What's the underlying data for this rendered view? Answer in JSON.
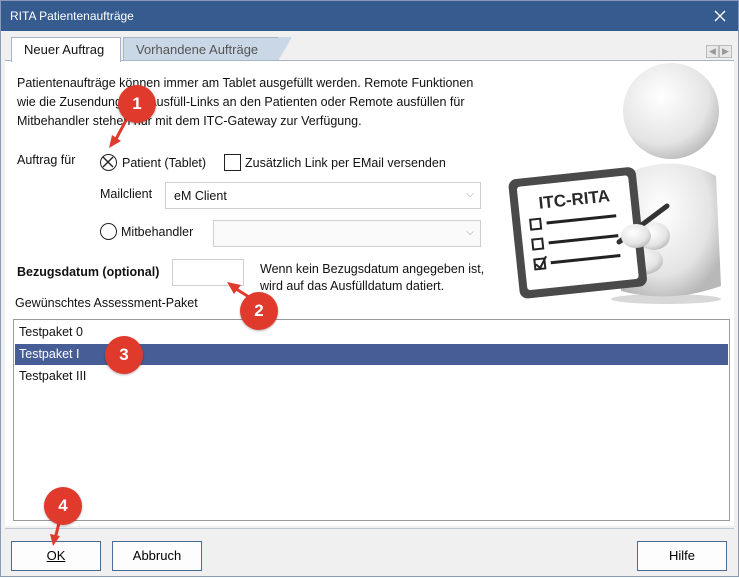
{
  "window": {
    "title": "RITA Patientenaufträge"
  },
  "tabs": [
    {
      "label": "Neuer Auftrag",
      "active": true
    },
    {
      "label": "Vorhandene Aufträge",
      "active": false
    }
  ],
  "description": {
    "line1": "Patientenaufträge können immer am Tablet ausgefüllt werden. Remote Funktionen",
    "line2": "wie die Zusendung des Ausfüll-Links an den Patienten oder Remote ausfüllen für",
    "line3": "Mitbehandler stehen nur mit dem ITC-Gateway zur Verfügung."
  },
  "form": {
    "auftrag_fuer_label": "Auftrag für",
    "patient_radio_label": "Patient (Tablet)",
    "email_link_label": "Zusätzlich Link per EMail versenden",
    "mailclient_label": "Mailclient",
    "mailclient_value": "eM Client",
    "mitbehandler_label": "Mitbehandler",
    "mitbehandler_value": "",
    "bezugsdatum_label": "Bezugsdatum (optional)",
    "bezugsdatum_value": "",
    "bezugsdatum_hint_line1": "Wenn kein Bezugsdatum angegeben ist,",
    "bezugsdatum_hint_line2": "wird auf das Ausfülldatum datiert.",
    "assessment_label": "Gewünschtes Assessment-Paket"
  },
  "assessment_packages": [
    {
      "label": "Testpaket 0",
      "selected": false
    },
    {
      "label": "Testpaket I",
      "selected": true
    },
    {
      "label": "Testpaket III",
      "selected": false
    }
  ],
  "illustration": {
    "board_text": "ITC-RITA"
  },
  "badges": [
    "1",
    "2",
    "3",
    "4"
  ],
  "buttons": {
    "ok": "OK",
    "abbruch": "Abbruch",
    "hilfe": "Hilfe"
  },
  "colors": {
    "titlebar": "#355b8f",
    "selection": "#475d96",
    "badge": "#e03a2d"
  }
}
